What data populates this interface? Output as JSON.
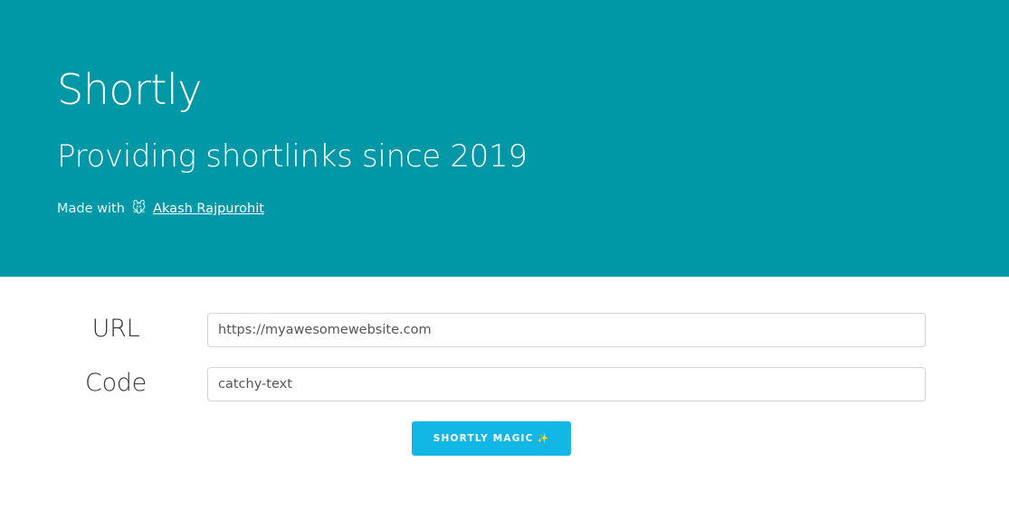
{
  "hero": {
    "title": "Shortly",
    "subtitle": "Providing shortlinks since 2019",
    "credit_prefix": "Made with",
    "credit_icon": "🐭",
    "author_name": "Akash Rajpurohit",
    "background": "#0097a7"
  },
  "form": {
    "url_label": "URL",
    "url_placeholder": "https://myawesomewebsite.com",
    "url_value": "",
    "code_label": "Code",
    "code_placeholder": "catchy-text",
    "code_value": "",
    "submit_label": "SHORTLY MAGIC",
    "submit_icon": "✨",
    "submit_color": "#12b7e6"
  }
}
